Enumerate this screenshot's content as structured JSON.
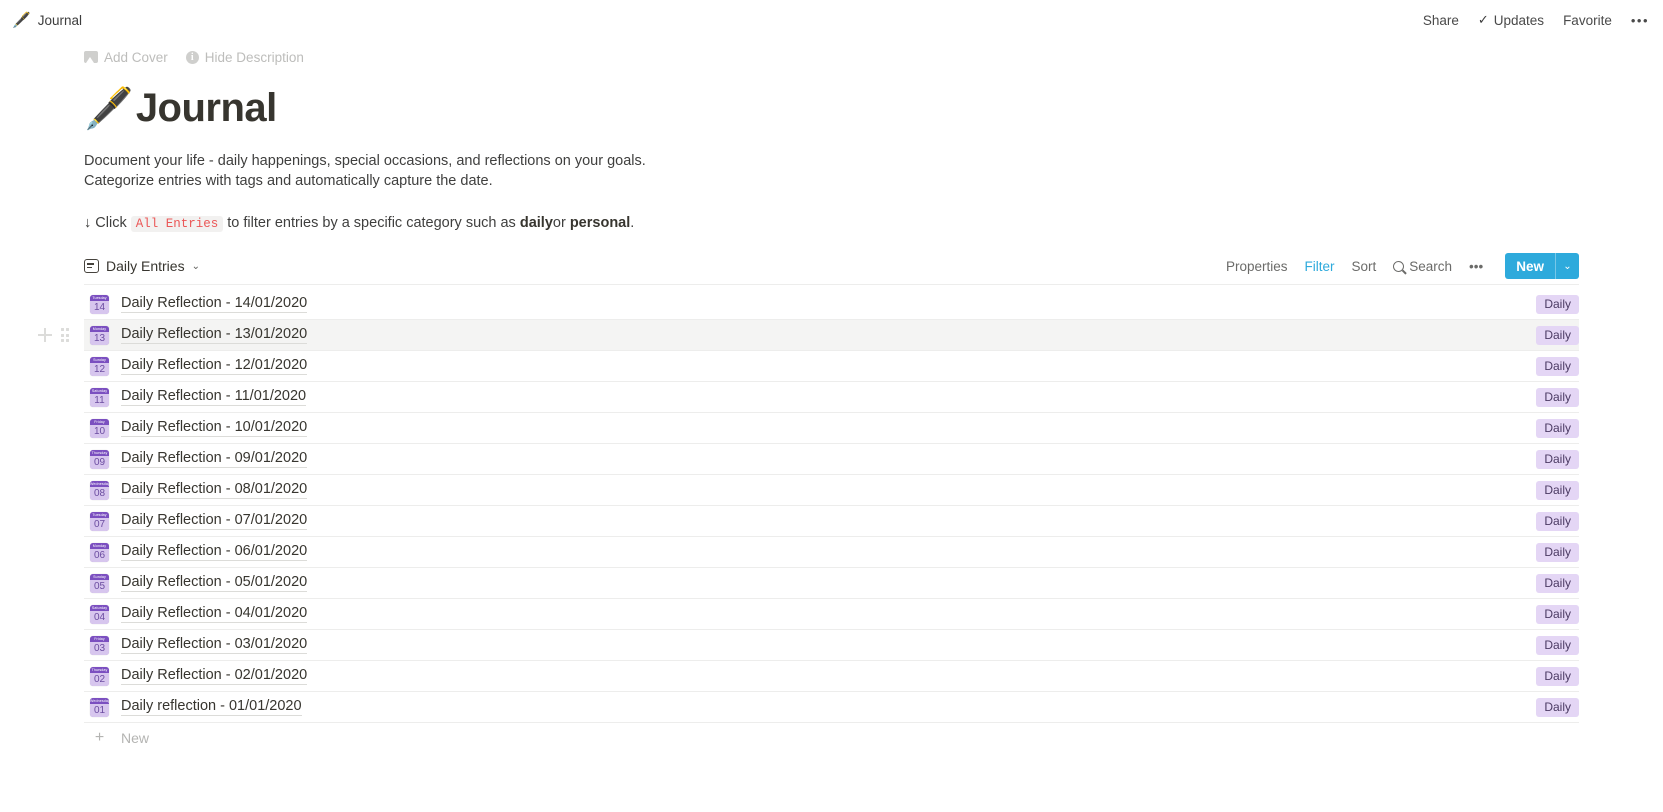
{
  "topbar": {
    "breadcrumb_emoji": "🖋️",
    "breadcrumb": "Journal",
    "share": "Share",
    "updates": "Updates",
    "updates_check": "✓",
    "favorite": "Favorite",
    "more": "•••"
  },
  "page_actions": {
    "add_cover": "Add Cover",
    "hide_description": "Hide Description"
  },
  "title": {
    "emoji": "🖋️",
    "text": "Journal"
  },
  "description": {
    "line1": "Document your life - daily happenings, special occasions, and reflections on your goals.",
    "line2": "Categorize entries with tags and automatically capture the date."
  },
  "hint": {
    "arrow": "↓",
    "prefix": "Click",
    "code": "All Entries",
    "middle": "to filter entries by a specific category such as",
    "bold1": "daily",
    "conjunction": "or",
    "bold2": "personal",
    "suffix": "."
  },
  "db_toolbar": {
    "view_name": "Daily Entries",
    "view_chevron": "⌄",
    "properties": "Properties",
    "filter": "Filter",
    "sort": "Sort",
    "search": "Search",
    "more": "•••",
    "new_label": "New",
    "new_chevron": "⌄",
    "accent_color": "#2eaadc"
  },
  "list": {
    "tag_color": "#e4d6f5",
    "new_row_label": "New",
    "rows": [
      {
        "weekday": "Tuesday",
        "day": "14",
        "title": "Daily Reflection - 14/01/2020",
        "tag": "Daily",
        "hovered": false
      },
      {
        "weekday": "Monday",
        "day": "13",
        "title": "Daily Reflection - 13/01/2020",
        "tag": "Daily",
        "hovered": true
      },
      {
        "weekday": "Sunday",
        "day": "12",
        "title": "Daily Reflection - 12/01/2020",
        "tag": "Daily",
        "hovered": false
      },
      {
        "weekday": "Saturday",
        "day": "11",
        "title": "Daily Reflection - 11/01/2020",
        "tag": "Daily",
        "hovered": false
      },
      {
        "weekday": "Friday",
        "day": "10",
        "title": "Daily Reflection - 10/01/2020",
        "tag": "Daily",
        "hovered": false
      },
      {
        "weekday": "Thursday",
        "day": "09",
        "title": "Daily Reflection - 09/01/2020",
        "tag": "Daily",
        "hovered": false
      },
      {
        "weekday": "Wednesday",
        "day": "08",
        "title": "Daily Reflection - 08/01/2020",
        "tag": "Daily",
        "hovered": false
      },
      {
        "weekday": "Tuesday",
        "day": "07",
        "title": "Daily Reflection - 07/01/2020",
        "tag": "Daily",
        "hovered": false
      },
      {
        "weekday": "Monday",
        "day": "06",
        "title": "Daily Reflection - 06/01/2020",
        "tag": "Daily",
        "hovered": false
      },
      {
        "weekday": "Sunday",
        "day": "05",
        "title": "Daily Reflection - 05/01/2020",
        "tag": "Daily",
        "hovered": false
      },
      {
        "weekday": "Saturday",
        "day": "04",
        "title": "Daily Reflection - 04/01/2020",
        "tag": "Daily",
        "hovered": false
      },
      {
        "weekday": "Friday",
        "day": "03",
        "title": "Daily Reflection - 03/01/2020",
        "tag": "Daily",
        "hovered": false
      },
      {
        "weekday": "Thursday",
        "day": "02",
        "title": "Daily Reflection - 02/01/2020",
        "tag": "Daily",
        "hovered": false
      },
      {
        "weekday": "Wednesday",
        "day": "01",
        "title": "Daily reflection - 01/01/2020",
        "tag": "Daily",
        "hovered": false
      }
    ]
  }
}
